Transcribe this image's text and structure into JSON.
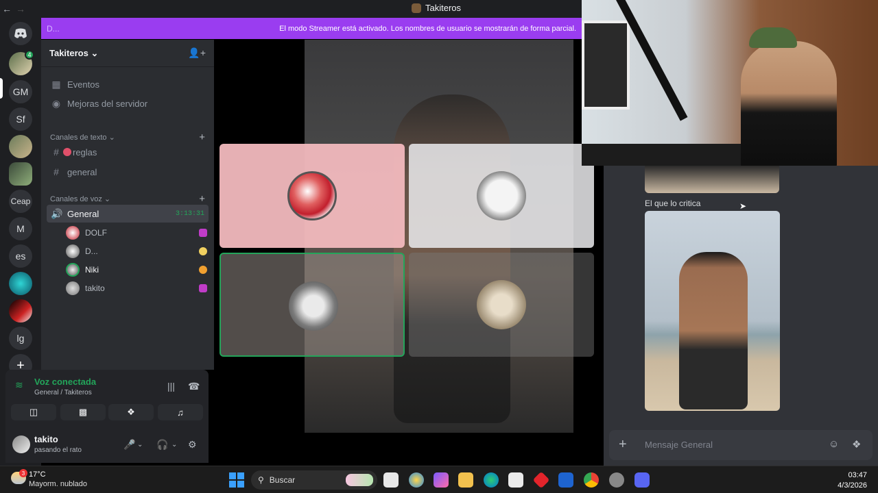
{
  "window": {
    "title": "Takiteros"
  },
  "banner": {
    "prefix": "D...",
    "message": "El modo Streamer está activado. Los nombres de usuario se mostrarán de forma parcial."
  },
  "rail": {
    "servers": [
      "GM",
      "Sf",
      "Ceap",
      "M",
      "es",
      "lg"
    ],
    "dm_badge": "4"
  },
  "sidebar": {
    "server_name": "Takiteros ⌄",
    "items": [
      {
        "icon": "calendar-icon",
        "label": "Eventos"
      },
      {
        "icon": "boost-icon",
        "label": "Mejoras del servidor"
      }
    ],
    "text_category": "Canales de texto ⌄",
    "text_channels": [
      "reglas",
      "general"
    ],
    "voice_category": "Canales de voz ⌄",
    "voice_channel": {
      "label": "General",
      "timer": "3:13:31"
    },
    "members": [
      {
        "name": "DOLF",
        "color": "#e0506a"
      },
      {
        "name": "D...",
        "color": "#f0c040"
      },
      {
        "name": "Niki",
        "color": "#f0a030"
      },
      {
        "name": "takito",
        "color": "#e0506a"
      }
    ]
  },
  "voice_panel": {
    "title": "Voz conectada",
    "subtitle": "General / Takiteros"
  },
  "user": {
    "name": "takito",
    "status": "pasando el rato"
  },
  "chat": {
    "caption": "El que lo critica",
    "placeholder": "Mensaje General"
  },
  "taskbar": {
    "temp": "17°C",
    "weather": "Mayorm. nublado",
    "weather_badge": "3",
    "search": "Buscar",
    "time": "03:47",
    "date": "4/3/2026"
  },
  "colors": {
    "accent": "#5865f2",
    "streamer_banner": "#9a3df0",
    "online": "#23a55a"
  }
}
